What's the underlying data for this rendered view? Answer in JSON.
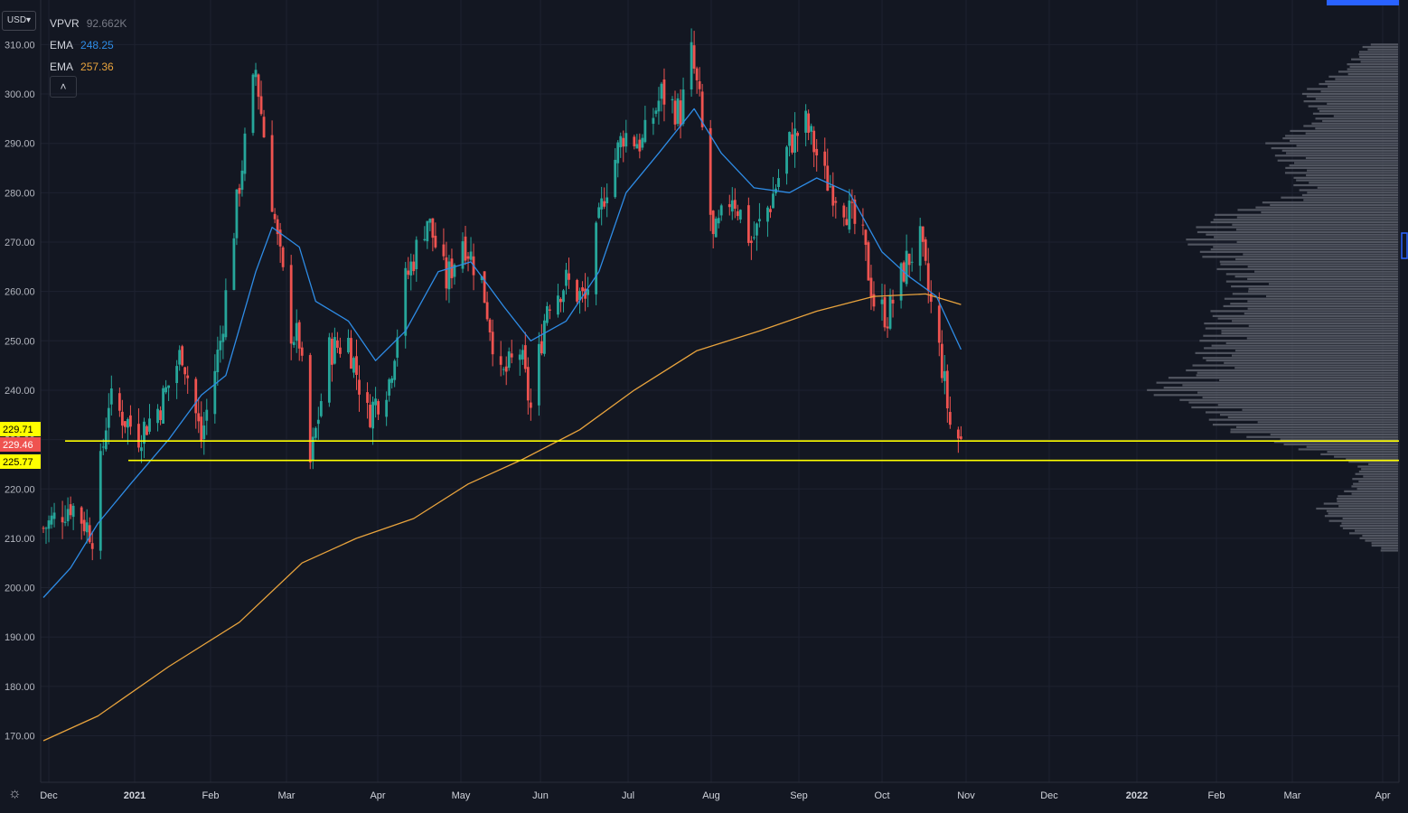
{
  "currency": {
    "label": "USD"
  },
  "legend": {
    "vpvr_label": "VPVR",
    "vpvr_value": "92.662K",
    "ema1_label": "EMA",
    "ema1_value": "248.25",
    "ema2_label": "EMA",
    "ema2_value": "257.36"
  },
  "collapse_label": "˄",
  "gear_icon": "☼",
  "colors": {
    "background": "#131722",
    "grid": "#1e2230",
    "up": "#26a69a",
    "down": "#ef5350",
    "ema_fast": "#2e8ce6",
    "ema_slow": "#e8a33d",
    "level_line": "#ffff00",
    "volume_profile": "#5d606b"
  },
  "chart_data": {
    "type": "candlestick",
    "y_ticks": [
      "310.00",
      "300.00",
      "290.00",
      "280.00",
      "270.00",
      "260.00",
      "250.00",
      "240.00",
      "230.00",
      "220.00",
      "210.00",
      "200.00",
      "190.00",
      "180.00",
      "170.00"
    ],
    "x_ticks": [
      "Dec",
      "2021",
      "Feb",
      "Mar",
      "Apr",
      "May",
      "Jun",
      "Jul",
      "Aug",
      "Sep",
      "Oct",
      "Nov",
      "Dec",
      "2022",
      "Feb",
      "Mar",
      "Apr"
    ],
    "ylim": [
      165,
      314
    ],
    "price_tags": [
      {
        "label": "229.71",
        "value": 229.71,
        "color": "#ffff00",
        "text": "#000000"
      },
      {
        "label": "229.46",
        "value": 229.46,
        "color": "#ef5350",
        "text": "#ffffff"
      },
      {
        "label": "225.77",
        "value": 225.77,
        "color": "#ffff00",
        "text": "#000000"
      }
    ],
    "horizontal_levels": [
      229.71,
      225.77
    ],
    "price_path": [
      [
        "2020-11-30",
        212
      ],
      [
        "2020-12-10",
        217
      ],
      [
        "2020-12-18",
        211
      ],
      [
        "2020-12-24",
        238
      ],
      [
        "2021-01-04",
        231
      ],
      [
        "2021-01-12",
        237
      ],
      [
        "2021-01-20",
        248
      ],
      [
        "2021-01-27",
        230
      ],
      [
        "2021-02-03",
        250
      ],
      [
        "2021-02-10",
        282
      ],
      [
        "2021-02-16",
        305
      ],
      [
        "2021-02-24",
        270
      ],
      [
        "2021-03-01",
        252
      ],
      [
        "2021-03-04",
        250
      ],
      [
        "2021-03-08",
        225
      ],
      [
        "2021-03-15",
        248
      ],
      [
        "2021-03-22",
        250
      ],
      [
        "2021-03-29",
        235
      ],
      [
        "2021-04-06",
        242
      ],
      [
        "2021-04-12",
        262
      ],
      [
        "2021-04-20",
        275
      ],
      [
        "2021-04-27",
        262
      ],
      [
        "2021-05-03",
        271
      ],
      [
        "2021-05-10",
        262
      ],
      [
        "2021-05-17",
        242
      ],
      [
        "2021-05-24",
        248
      ],
      [
        "2021-05-28",
        236
      ],
      [
        "2021-06-03",
        258
      ],
      [
        "2021-06-10",
        262
      ],
      [
        "2021-06-17",
        258
      ],
      [
        "2021-06-24",
        280
      ],
      [
        "2021-07-01",
        292
      ],
      [
        "2021-07-08",
        290
      ],
      [
        "2021-07-15",
        300
      ],
      [
        "2021-07-22",
        296
      ],
      [
        "2021-07-26",
        308
      ],
      [
        "2021-07-29",
        298
      ],
      [
        "2021-08-03",
        270
      ],
      [
        "2021-08-10",
        280
      ],
      [
        "2021-08-17",
        270
      ],
      [
        "2021-08-24",
        278
      ],
      [
        "2021-08-31",
        290
      ],
      [
        "2021-09-06",
        294
      ],
      [
        "2021-09-13",
        283
      ],
      [
        "2021-09-20",
        278
      ],
      [
        "2021-09-27",
        270
      ],
      [
        "2021-10-01",
        258
      ],
      [
        "2021-10-06",
        255
      ],
      [
        "2021-10-13",
        266
      ],
      [
        "2021-10-18",
        270
      ],
      [
        "2021-10-21",
        260
      ],
      [
        "2021-10-26",
        245
      ],
      [
        "2021-10-29",
        233
      ],
      [
        "2021-11-02",
        229.46
      ]
    ],
    "ema_fast": {
      "name": "EMA",
      "points": [
        [
          "2020-11-30",
          198
        ],
        [
          "2020-12-10",
          204
        ],
        [
          "2020-12-20",
          213
        ],
        [
          "2021-01-01",
          221
        ],
        [
          "2021-01-15",
          230
        ],
        [
          "2021-01-27",
          239
        ],
        [
          "2021-02-05",
          243
        ],
        [
          "2021-02-16",
          264
        ],
        [
          "2021-02-22",
          273
        ],
        [
          "2021-03-04",
          269
        ],
        [
          "2021-03-10",
          258
        ],
        [
          "2021-03-22",
          254
        ],
        [
          "2021-04-01",
          246
        ],
        [
          "2021-04-12",
          252
        ],
        [
          "2021-04-24",
          264
        ],
        [
          "2021-05-06",
          266
        ],
        [
          "2021-05-18",
          257
        ],
        [
          "2021-05-28",
          250
        ],
        [
          "2021-06-10",
          254
        ],
        [
          "2021-06-22",
          264
        ],
        [
          "2021-07-02",
          280
        ],
        [
          "2021-07-14",
          288
        ],
        [
          "2021-07-27",
          297
        ],
        [
          "2021-08-06",
          288
        ],
        [
          "2021-08-18",
          281
        ],
        [
          "2021-08-31",
          280
        ],
        [
          "2021-09-10",
          283
        ],
        [
          "2021-09-22",
          280
        ],
        [
          "2021-10-04",
          268
        ],
        [
          "2021-10-14",
          263
        ],
        [
          "2021-10-24",
          259
        ],
        [
          "2021-11-02",
          248.25
        ]
      ]
    },
    "ema_slow": {
      "name": "EMA",
      "points": [
        [
          "2020-11-30",
          169
        ],
        [
          "2020-12-20",
          174
        ],
        [
          "2021-01-15",
          184
        ],
        [
          "2021-02-10",
          193
        ],
        [
          "2021-03-05",
          205
        ],
        [
          "2021-03-25",
          210
        ],
        [
          "2021-04-15",
          214
        ],
        [
          "2021-05-05",
          221
        ],
        [
          "2021-05-25",
          226
        ],
        [
          "2021-06-15",
          232
        ],
        [
          "2021-07-05",
          240
        ],
        [
          "2021-07-28",
          248
        ],
        [
          "2021-08-20",
          252
        ],
        [
          "2021-09-10",
          256
        ],
        [
          "2021-10-01",
          259
        ],
        [
          "2021-10-20",
          259.5
        ],
        [
          "2021-11-02",
          257.36
        ]
      ]
    },
    "volume_profile": [
      [
        310,
        0.1
      ],
      [
        305,
        0.17
      ],
      [
        300,
        0.3
      ],
      [
        295,
        0.25
      ],
      [
        290,
        0.4
      ],
      [
        285,
        0.35
      ],
      [
        280,
        0.3
      ],
      [
        275,
        0.58
      ],
      [
        270,
        0.65
      ],
      [
        265,
        0.55
      ],
      [
        260,
        0.5
      ],
      [
        255,
        0.58
      ],
      [
        250,
        0.6
      ],
      [
        245,
        0.62
      ],
      [
        240,
        0.78
      ],
      [
        236,
        0.6
      ],
      [
        232,
        0.55
      ],
      [
        228,
        0.3
      ],
      [
        225,
        0.12
      ],
      [
        220,
        0.15
      ],
      [
        216,
        0.25
      ],
      [
        213,
        0.2
      ],
      [
        210,
        0.12
      ],
      [
        207,
        0.04
      ]
    ]
  }
}
